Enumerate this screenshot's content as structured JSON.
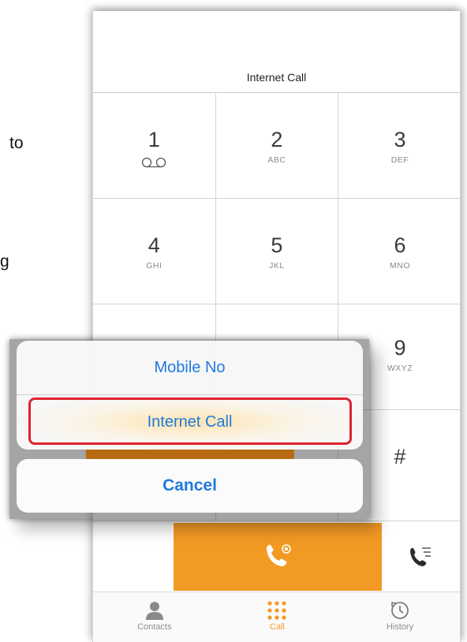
{
  "document": {
    "fragment_1": "to",
    "fragment_2": "g"
  },
  "dialer": {
    "mode_label": "Internet Call",
    "keys": [
      {
        "digit": "1",
        "letters": ""
      },
      {
        "digit": "2",
        "letters": "ABC"
      },
      {
        "digit": "3",
        "letters": "DEF"
      },
      {
        "digit": "4",
        "letters": "GHI"
      },
      {
        "digit": "5",
        "letters": "JKL"
      },
      {
        "digit": "6",
        "letters": "MNO"
      },
      {
        "digit": "9",
        "letters": "WXYZ"
      },
      {
        "digit": "#",
        "letters": ""
      }
    ]
  },
  "action_sheet": {
    "option_1": "Mobile No",
    "option_2": "Internet Call",
    "cancel": "Cancel",
    "highlight_color": "#e0232e"
  },
  "tabs": [
    {
      "label": "Contacts",
      "icon": "person-icon",
      "active": false
    },
    {
      "label": "Call",
      "icon": "keypad-grid-icon",
      "active": true
    },
    {
      "label": "History",
      "icon": "clock-history-icon",
      "active": false
    }
  ],
  "colors": {
    "accent": "#f39a24",
    "link_blue": "#1f7ae0"
  }
}
